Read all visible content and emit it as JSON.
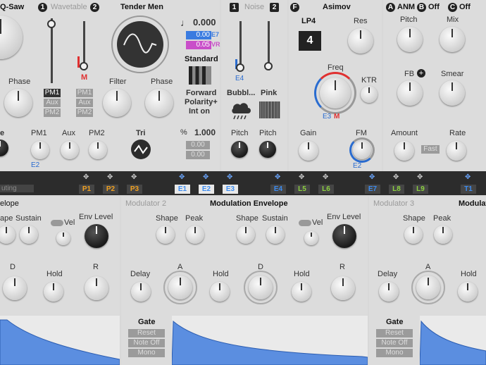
{
  "osc": {
    "left_title": "Q-Saw",
    "wavetable_label": "Wavetable",
    "osc1_badge": "1",
    "osc2_badge": "2",
    "wavetable_name": "Tender Men",
    "phase_label": "Phase",
    "filter_label": "Filter",
    "phase2_label": "Phase",
    "pm_buttons": [
      "PM1",
      "Aux",
      "PM2"
    ],
    "pm_buttons2": [
      "PM1",
      "Aux",
      "PM2"
    ],
    "m_marker": "M",
    "fm_labels": [
      "e",
      "PM1",
      "Aux",
      "PM2"
    ],
    "e2_label": "E2",
    "tri_label": "Tri"
  },
  "pitch_box": {
    "note_icon": "♩",
    "coarse": "0.000",
    "val_blue": "0.00",
    "val_blue_tag": "E7",
    "val_pink": "0.05",
    "val_pink_tag": "VR",
    "mode": "Standard",
    "direction": "Forward",
    "polarity": "Polarity+",
    "int": "Int on",
    "pct_icon": "%",
    "pct_value": "1.000",
    "small_a": "0.00",
    "small_b": "0.00"
  },
  "noise": {
    "badge_l": "1",
    "title": "Noise",
    "badge_r": "2",
    "e4_label": "E4",
    "bubble_label": "Bubbl...",
    "pink_label": "Pink",
    "pitch1": "Pitch",
    "pitch2": "Pitch"
  },
  "filter": {
    "badge": "F",
    "name": "Asimov",
    "type": "LP4",
    "type_num": "4",
    "res": "Res",
    "freq": "Freq",
    "ktr": "KTR",
    "e3_label": "E3",
    "m_label": "M",
    "gain": "Gain",
    "fm": "FM",
    "e2_label": "E2"
  },
  "fx": {
    "a_badge": "A",
    "a_label": "ANM",
    "b_badge": "B",
    "b_label": "Off",
    "c_badge": "C",
    "c_label": "Off",
    "pitch": "Pitch",
    "mix": "Mix",
    "fb": "FB",
    "smear": "Smear",
    "amount": "Amount",
    "rate": "Rate",
    "fast": "Fast"
  },
  "mod_bar": {
    "routing": "uting",
    "items": [
      {
        "label": "P1",
        "color": "#f0a020"
      },
      {
        "label": "P2",
        "color": "#f0a020"
      },
      {
        "label": "P3",
        "color": "#f0a020"
      },
      {
        "label": "E1",
        "color": "#3c8cf0"
      },
      {
        "label": "E2",
        "color": "#3c8cf0"
      },
      {
        "label": "E3",
        "color": "#3c8cf0"
      },
      {
        "label": "E4",
        "color": "#3c8cf0"
      },
      {
        "label": "L5",
        "color": "#8cd040"
      },
      {
        "label": "L6",
        "color": "#8cd040"
      },
      {
        "label": "E7",
        "color": "#3c8cf0"
      },
      {
        "label": "L8",
        "color": "#8cd040"
      },
      {
        "label": "L9",
        "color": "#8cd040"
      },
      {
        "label": "T1",
        "color": "#3c8cf0"
      }
    ]
  },
  "mod1": {
    "title": "elope",
    "shape": "ape",
    "sustain": "Sustain",
    "vel": "Vel",
    "env_level": "Env Level",
    "d": "D",
    "hold": "Hold",
    "r": "R"
  },
  "mod2": {
    "slot": "Modulator 2",
    "title": "Modulation Envelope",
    "shape": "Shape",
    "peak": "Peak",
    "shape2": "Shape",
    "sustain": "Sustain",
    "vel": "Vel",
    "env_level": "Env Level",
    "delay": "Delay",
    "a": "A",
    "hold": "Hold",
    "d": "D",
    "hold2": "Hold",
    "r": "R",
    "gate": "Gate",
    "reset": "Reset",
    "note_off": "Note Off",
    "mono": "Mono"
  },
  "mod3": {
    "slot": "Modulator 3",
    "title": "Modulati",
    "shape": "Shape",
    "peak": "Peak",
    "delay": "Delay",
    "a": "A",
    "hold": "Hold",
    "gate": "Gate",
    "reset": "Reset",
    "note_off": "Note Off",
    "mono": "Mono"
  }
}
